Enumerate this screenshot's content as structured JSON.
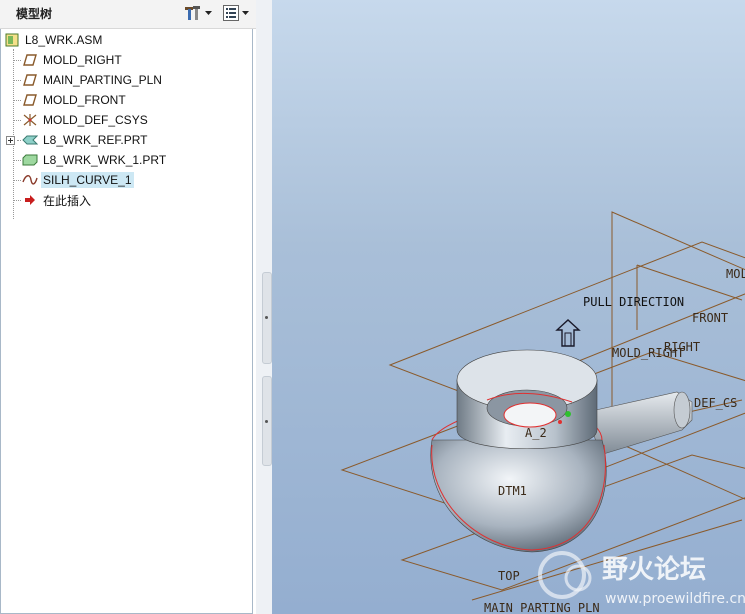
{
  "panel": {
    "title": "模型树"
  },
  "tree": {
    "items": [
      {
        "label": "L8_WRK.ASM",
        "icon": "assembly-icon"
      },
      {
        "label": "MOLD_RIGHT",
        "icon": "datum-plane-icon"
      },
      {
        "label": "MAIN_PARTING_PLN",
        "icon": "datum-plane-icon"
      },
      {
        "label": "MOLD_FRONT",
        "icon": "datum-plane-icon"
      },
      {
        "label": "MOLD_DEF_CSYS",
        "icon": "coordinate-system-icon"
      },
      {
        "label": "L8_WRK_REF.PRT",
        "icon": "reference-part-icon"
      },
      {
        "label": "L8_WRK_WRK_1.PRT",
        "icon": "workpiece-part-icon"
      },
      {
        "label": "SILH_CURVE_1",
        "icon": "curve-icon",
        "selected": true
      },
      {
        "label": "在此插入",
        "icon": "insert-here-arrow-icon"
      }
    ]
  },
  "viewport": {
    "pull_direction": "PULL DIRECTION",
    "front": "FRONT",
    "mold_right": "MOLD_RIGHT",
    "right": "RIGHT",
    "mol": "MOL",
    "def_csys": "DEF_CS",
    "a2": "A_2",
    "dtm1": "DTM1",
    "top": "TOP",
    "main_parting": "MAIN_PARTING_PLN",
    "watermark_cn": "野火论坛",
    "watermark_url": "www.proewildfire.cn"
  },
  "colors": {
    "datum_brown": "#8a5a2b",
    "silhouette_red": "#e03030",
    "selection_bg": "#cde8f4"
  }
}
